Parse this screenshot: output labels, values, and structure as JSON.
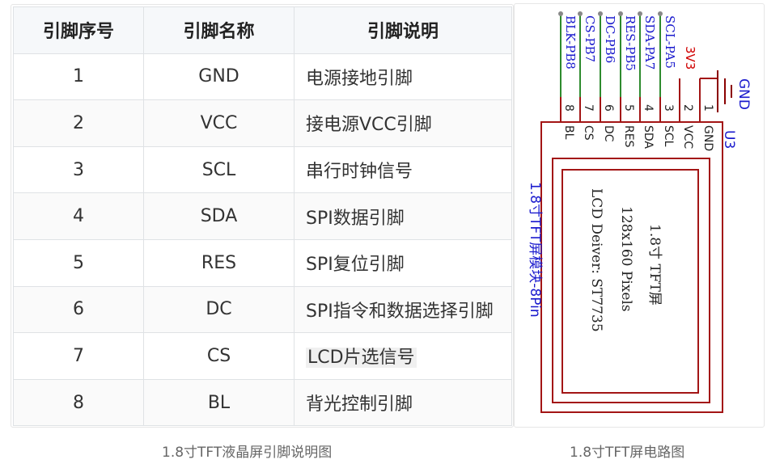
{
  "table": {
    "headers": [
      "引脚序号",
      "引脚名称",
      "引脚说明"
    ],
    "rows": [
      {
        "num": "1",
        "name": "GND",
        "desc": "电源接地引脚"
      },
      {
        "num": "2",
        "name": "VCC",
        "desc": "接电源VCC引脚"
      },
      {
        "num": "3",
        "name": "SCL",
        "desc": "串行时钟信号"
      },
      {
        "num": "4",
        "name": "SDA",
        "desc": "SPI数据引脚"
      },
      {
        "num": "5",
        "name": "RES",
        "desc": "SPI复位引脚"
      },
      {
        "num": "6",
        "name": "DC",
        "desc": "SPI指令和数据选择引脚"
      },
      {
        "num": "7",
        "name": "CS",
        "desc": "LCD片选信号"
      },
      {
        "num": "8",
        "name": "BL",
        "desc": "背光控制引脚"
      }
    ]
  },
  "schematic": {
    "net_labels": [
      "BLK-PB8",
      "CS-PB7",
      "DC-PB6",
      "RES-PB5",
      "SDA-PA7",
      "SCL-PA5"
    ],
    "power_3v3": "3V3",
    "gnd_label": "GND",
    "pin_numbers": [
      "8",
      "7",
      "6",
      "5",
      "4",
      "3",
      "2",
      "1"
    ],
    "pin_names": [
      "BL",
      "CS",
      "DC",
      "RES",
      "SDA",
      "SCL",
      "VCC",
      "GND"
    ],
    "designator": "U3",
    "module_label": "1.8寸TFT屏模块-8Pin",
    "lcd_text": [
      "1.8寸 TFT屏",
      "128x160 Pixels",
      "LCD Deiver: ST7735"
    ],
    "colors": {
      "wire": "#2e8b2e",
      "net_text": "#1a1acd",
      "power": "#d00000",
      "body": "#a31515",
      "ground": "#8b0000"
    }
  },
  "captions": {
    "left": "1.8寸TFT液晶屏引脚说明图",
    "right": "1.8寸TFT屏电路图"
  }
}
